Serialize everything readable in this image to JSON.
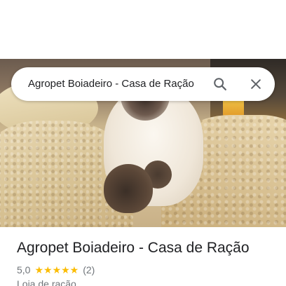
{
  "search": {
    "query": "Agropet Boiadeiro - Casa de Ração"
  },
  "icons": {
    "search": "search-icon",
    "close": "close-icon"
  },
  "place": {
    "name": "Agropet Boiadeiro - Casa de Ração",
    "rating": "5,0",
    "stars": "★★★★★",
    "star_count": 5,
    "reviews": "(2)",
    "category": "Loja de ração"
  },
  "colors": {
    "star": "#fbbc04",
    "text_primary": "#202124",
    "text_secondary": "#70757a"
  }
}
